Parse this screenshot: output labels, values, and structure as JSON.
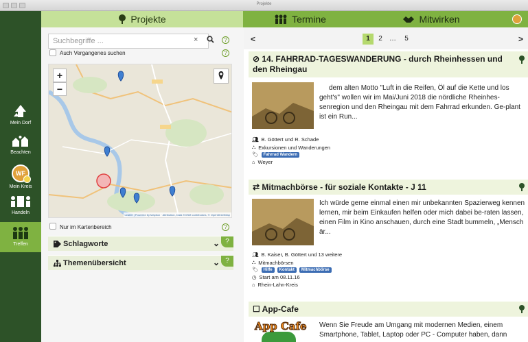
{
  "window": {
    "title": "Projekte"
  },
  "sidebar": {
    "items": [
      {
        "label": "Mein Dorf"
      },
      {
        "label": "Beachten"
      },
      {
        "label": "Mein Kreis"
      },
      {
        "label": "Handeln"
      },
      {
        "label": "Treffen"
      }
    ],
    "active": "Treffen",
    "avatar_text": "WF"
  },
  "tabs": {
    "projekte": "Projekte",
    "termine": "Termine",
    "mitwirken": "Mitwirken"
  },
  "search": {
    "placeholder": "Suchbegriffe ...",
    "clear": "×",
    "past_label": "Auch Vergangenes suchen",
    "map_only_label": "Nur im Kartenbereich"
  },
  "map": {
    "zoom_in": "+",
    "zoom_out": "−",
    "attribution": "Leaflet | Powered by Mapbox · Attribution, Data ©OSM contributors, © OpenStreetMap"
  },
  "accordion": {
    "schlagworte": "Schlagworte",
    "themen": "Themenübersicht"
  },
  "help": "?",
  "pager": {
    "prev": "<",
    "next": ">",
    "pages": [
      "1",
      "2",
      "…",
      "5"
    ],
    "current": "1"
  },
  "cards": [
    {
      "title": "⊘ 14. FAHRRAD-TAGESWANDERUNG - durch Rheinhessen und den Rheingau",
      "text": "dem alten Motto \"Luft in die Reifen, Öl auf die Kette und los geht's\" wollen wir im Mai/Juni 2018 die nördliche Rheinhes-senregion und den Rheingau mit dem Fahrrad erkunden. Ge-plant ist ein Run...",
      "people": "B. Göttert und R. Schade",
      "category": "Exkursionen und Wanderungen",
      "tags": [
        "Fahrrad Wandern"
      ],
      "location": "Weyer"
    },
    {
      "title": "⇄ Mitmachbörse - für soziale Kontakte - J 11",
      "text": "Ich würde gerne einmal einen mir unbekannten Spazierweg kennen lernen, mir beim Einkaufen helfen oder mich dabei be-raten lassen, einen Film in Kino anschauen, durch eine Stadt bummeln, „Mensch är...",
      "people": "B. Kaiser, B. Göttert und 13 weitere",
      "category": "Mitmachbörsen",
      "tags": [
        "Hilfe",
        "Kontakt",
        "Mitmachbörse"
      ],
      "date": "Start am 08.11.16",
      "location": "Rhein-Lahn-Kreis"
    },
    {
      "title": "☐ App-Cafe",
      "img_text": "App Cafe",
      "text": "Wenn Sie Freude am Umgang mit modernen Medien, einem Smartphone, Tablet, Laptop oder PC - Computer haben, dann"
    }
  ],
  "colors": {
    "sidebar": "#2d5228",
    "nav_active": "#c5e199",
    "nav": "#7fb241",
    "accent": "#6f9f2a",
    "tag": "#3b6cb3"
  }
}
